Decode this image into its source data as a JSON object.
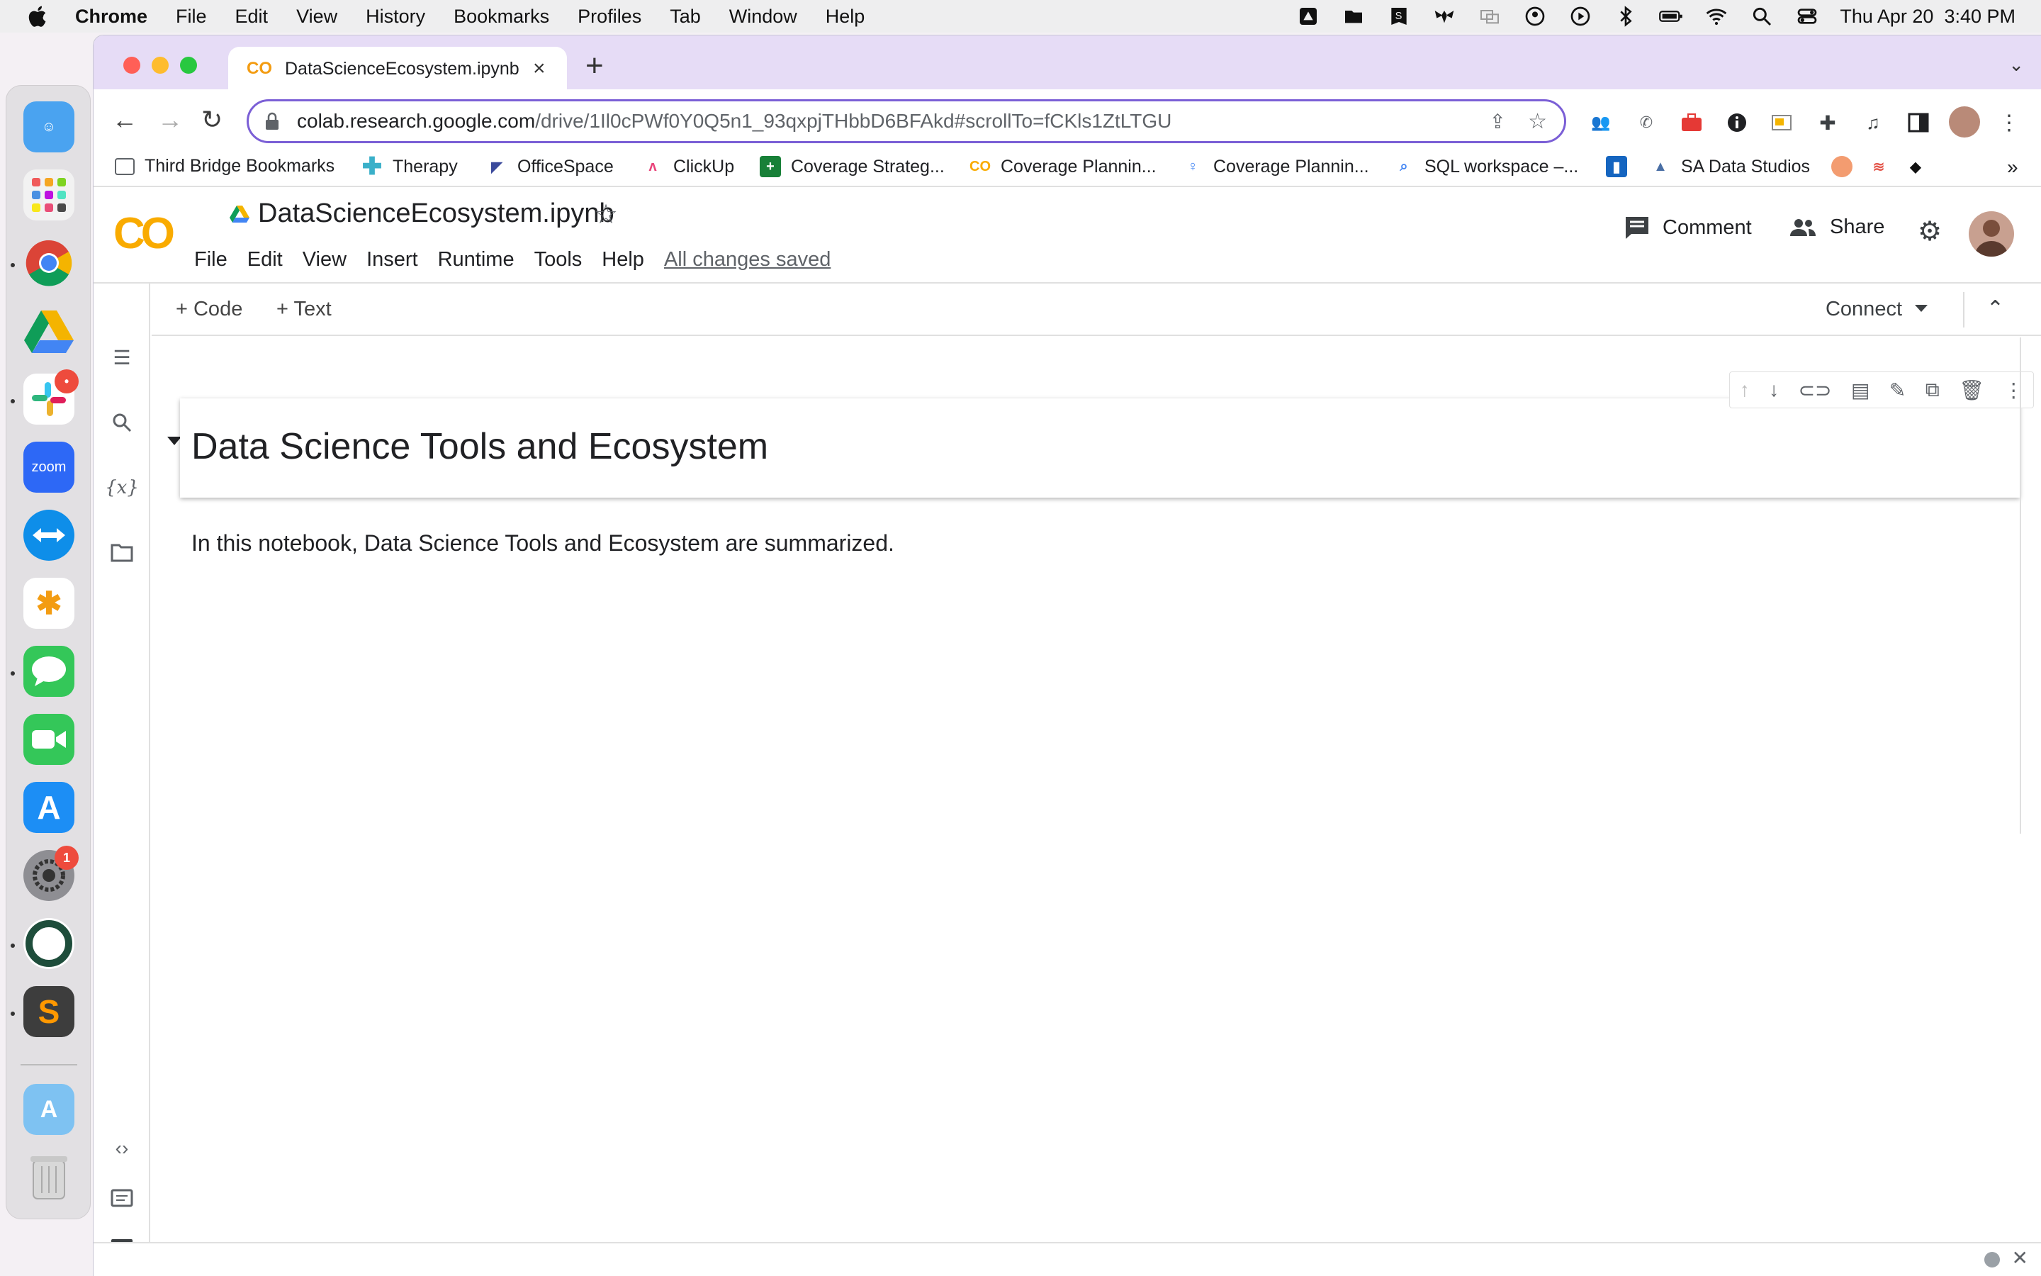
{
  "menubar": {
    "app": "Chrome",
    "items": [
      "File",
      "Edit",
      "View",
      "History",
      "Bookmarks",
      "Profiles",
      "Tab",
      "Window",
      "Help"
    ],
    "clock": "Thu Apr 20  3:40 PM"
  },
  "dock": {
    "zoom_label": "zoom",
    "slack_badge": "•",
    "settings_badge": "1"
  },
  "browser": {
    "tab_title": "DataScienceEcosystem.ipynb - Colab",
    "tab_favicon": "CO",
    "url_host": "colab.research.google.com",
    "url_path": "/drive/1Il0cPWf0Y0Q5n1_93qxpjTHbbD6BFAkd#scrollTo=fCKls1ZtLTGU"
  },
  "bookmarks": [
    {
      "label": "Third Bridge Bookmarks",
      "icon": "folder-icon",
      "color": "#5f6368"
    },
    {
      "label": "Therapy",
      "icon": "plus-icon",
      "color": "#3ab0c9"
    },
    {
      "label": "OfficeSpace",
      "icon": "officespace-icon",
      "color": "#3b4a9c"
    },
    {
      "label": "ClickUp",
      "icon": "clickup-icon",
      "color": "#e9437a"
    },
    {
      "label": "Coverage Strateg...",
      "icon": "sheets-icon",
      "color": "#188038"
    },
    {
      "label": "Coverage Plannin...",
      "icon": "colab-icon",
      "color": "#f9ab00"
    },
    {
      "label": "Coverage Plannin...",
      "icon": "person-icon",
      "color": "#4285f4"
    },
    {
      "label": "SQL workspace –...",
      "icon": "sql-icon",
      "color": "#4285f4"
    },
    {
      "label": "",
      "icon": "trello-icon",
      "color": "#1565c0"
    },
    {
      "label": "SA Data Studios",
      "icon": "datastudio-icon",
      "color": "#4a6fa5"
    },
    {
      "label": "",
      "icon": "face-icon",
      "color": "#f39c70"
    },
    {
      "label": "",
      "icon": "wave-icon",
      "color": "#e4574c"
    },
    {
      "label": "",
      "icon": "shield-icon",
      "color": "#111111"
    }
  ],
  "bookmarks_more": "»",
  "colab": {
    "logo": "CO",
    "notebook_title": "DataScienceEcosystem.ipynb",
    "menu": [
      "File",
      "Edit",
      "View",
      "Insert",
      "Runtime",
      "Tools",
      "Help"
    ],
    "saved_status": "All changes saved",
    "comment_label": "Comment",
    "share_label": "Share",
    "add_code_label": "+ Code",
    "add_text_label": "+ Text",
    "connect_label": "Connect",
    "heading": "Data Science Tools and Ecosystem",
    "paragraph": "In this notebook, Data Science Tools and Ecosystem are summarized.",
    "variables_icon_label": "{x}"
  },
  "colors": {
    "accent": "#7b5fd6",
    "tabstrip": "#e6dcf6",
    "colab_orange": "#f9ab00"
  }
}
